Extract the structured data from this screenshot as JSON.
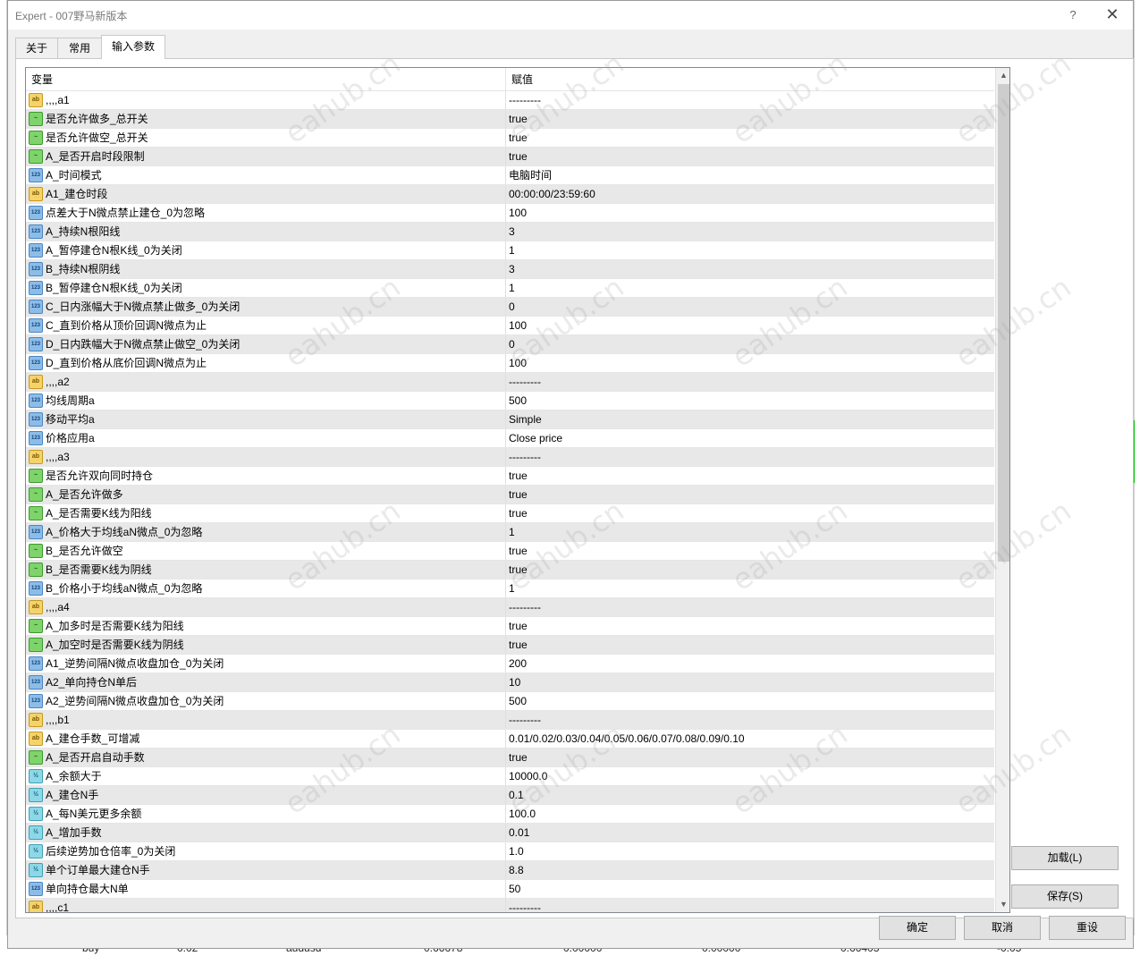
{
  "window": {
    "title": "Expert - 007野马新版本",
    "help_label": "?",
    "close_label": "✕"
  },
  "tabs": [
    {
      "label": "关于"
    },
    {
      "label": "常用"
    },
    {
      "label": "输入参数"
    }
  ],
  "grid": {
    "headers": {
      "variable": "变量",
      "value": "赋值"
    },
    "rows": [
      {
        "type": "ab",
        "name": ",,,,a1",
        "value": "---------"
      },
      {
        "type": "bool",
        "name": "是否允许做多_总开关",
        "value": "true"
      },
      {
        "type": "bool",
        "name": "是否允许做空_总开关",
        "value": "true"
      },
      {
        "type": "bool",
        "name": "A_是否开启时段限制",
        "value": "true"
      },
      {
        "type": "123",
        "name": "A_时间模式",
        "value": "电脑时间"
      },
      {
        "type": "ab",
        "name": "A1_建仓时段",
        "value": "00:00:00/23:59:60"
      },
      {
        "type": "123",
        "name": "点差大于N微点禁止建仓_0为忽略",
        "value": "100"
      },
      {
        "type": "123",
        "name": "A_持续N根阳线",
        "value": "3"
      },
      {
        "type": "123",
        "name": "A_暂停建仓N根K线_0为关闭",
        "value": "1"
      },
      {
        "type": "123",
        "name": "B_持续N根阴线",
        "value": "3"
      },
      {
        "type": "123",
        "name": "B_暂停建仓N根K线_0为关闭",
        "value": "1"
      },
      {
        "type": "123",
        "name": "C_日内涨幅大于N微点禁止做多_0为关闭",
        "value": "0"
      },
      {
        "type": "123",
        "name": "C_直到价格从顶价回调N微点为止",
        "value": "100"
      },
      {
        "type": "123",
        "name": "D_日内跌幅大于N微点禁止做空_0为关闭",
        "value": "0"
      },
      {
        "type": "123",
        "name": "D_直到价格从底价回调N微点为止",
        "value": "100"
      },
      {
        "type": "ab",
        "name": ",,,,a2",
        "value": "---------"
      },
      {
        "type": "123",
        "name": "均线周期a",
        "value": "500"
      },
      {
        "type": "123",
        "name": "移动平均a",
        "value": "Simple"
      },
      {
        "type": "123",
        "name": "价格应用a",
        "value": "Close price"
      },
      {
        "type": "ab",
        "name": ",,,,a3",
        "value": "---------"
      },
      {
        "type": "bool",
        "name": "是否允许双向同时持仓",
        "value": "true"
      },
      {
        "type": "bool",
        "name": "A_是否允许做多",
        "value": "true"
      },
      {
        "type": "bool",
        "name": "A_是否需要K线为阳线",
        "value": "true"
      },
      {
        "type": "123",
        "name": "A_价格大于均线aN微点_0为忽略",
        "value": "1"
      },
      {
        "type": "bool",
        "name": "B_是否允许做空",
        "value": "true"
      },
      {
        "type": "bool",
        "name": "B_是否需要K线为阴线",
        "value": "true"
      },
      {
        "type": "123",
        "name": "B_价格小于均线aN微点_0为忽略",
        "value": "1"
      },
      {
        "type": "ab",
        "name": ",,,,a4",
        "value": "---------"
      },
      {
        "type": "bool",
        "name": "A_加多时是否需要K线为阳线",
        "value": "true"
      },
      {
        "type": "bool",
        "name": "A_加空时是否需要K线为阴线",
        "value": "true"
      },
      {
        "type": "123",
        "name": "A1_逆势间隔N微点收盘加仓_0为关闭",
        "value": "200"
      },
      {
        "type": "123",
        "name": "A2_单向持仓N单后",
        "value": "10"
      },
      {
        "type": "123",
        "name": "A2_逆势间隔N微点收盘加仓_0为关闭",
        "value": "500"
      },
      {
        "type": "ab",
        "name": ",,,,b1",
        "value": "---------"
      },
      {
        "type": "ab",
        "name": "A_建仓手数_可增减",
        "value": "0.01/0.02/0.03/0.04/0.05/0.06/0.07/0.08/0.09/0.10"
      },
      {
        "type": "bool",
        "name": "A_是否开启自动手数",
        "value": "true"
      },
      {
        "type": "dbl",
        "name": "A_余额大于",
        "value": "10000.0"
      },
      {
        "type": "dbl",
        "name": "A_建仓N手",
        "value": "0.1"
      },
      {
        "type": "dbl",
        "name": "A_每N美元更多余额",
        "value": "100.0"
      },
      {
        "type": "dbl",
        "name": "A_增加手数",
        "value": "0.01"
      },
      {
        "type": "dbl",
        "name": "后续逆势加仓倍率_0为关闭",
        "value": "1.0"
      },
      {
        "type": "dbl",
        "name": "单个订单最大建仓N手",
        "value": "8.8"
      },
      {
        "type": "123",
        "name": "单向持仓最大N单",
        "value": "50"
      },
      {
        "type": "ab",
        "name": ",,,,c1",
        "value": "---------"
      }
    ]
  },
  "icons": {
    "ab": "ab",
    "123": "123",
    "bool": "~",
    "dbl": "½"
  },
  "buttons": {
    "load": "加载(L)",
    "save": "保存(S)",
    "ok": "确定",
    "cancel": "取消",
    "reset": "重设"
  },
  "scrollbar": {
    "up": "▲",
    "down": "▼"
  },
  "watermark": "eahub.cn",
  "background_row": {
    "type": "buy",
    "lots": "0.02",
    "symbol": "audusd",
    "price": "0.66678",
    "sl": "0.00000",
    "tp": "0.00000",
    "current": "0.66403",
    "profit": "-0.05"
  }
}
